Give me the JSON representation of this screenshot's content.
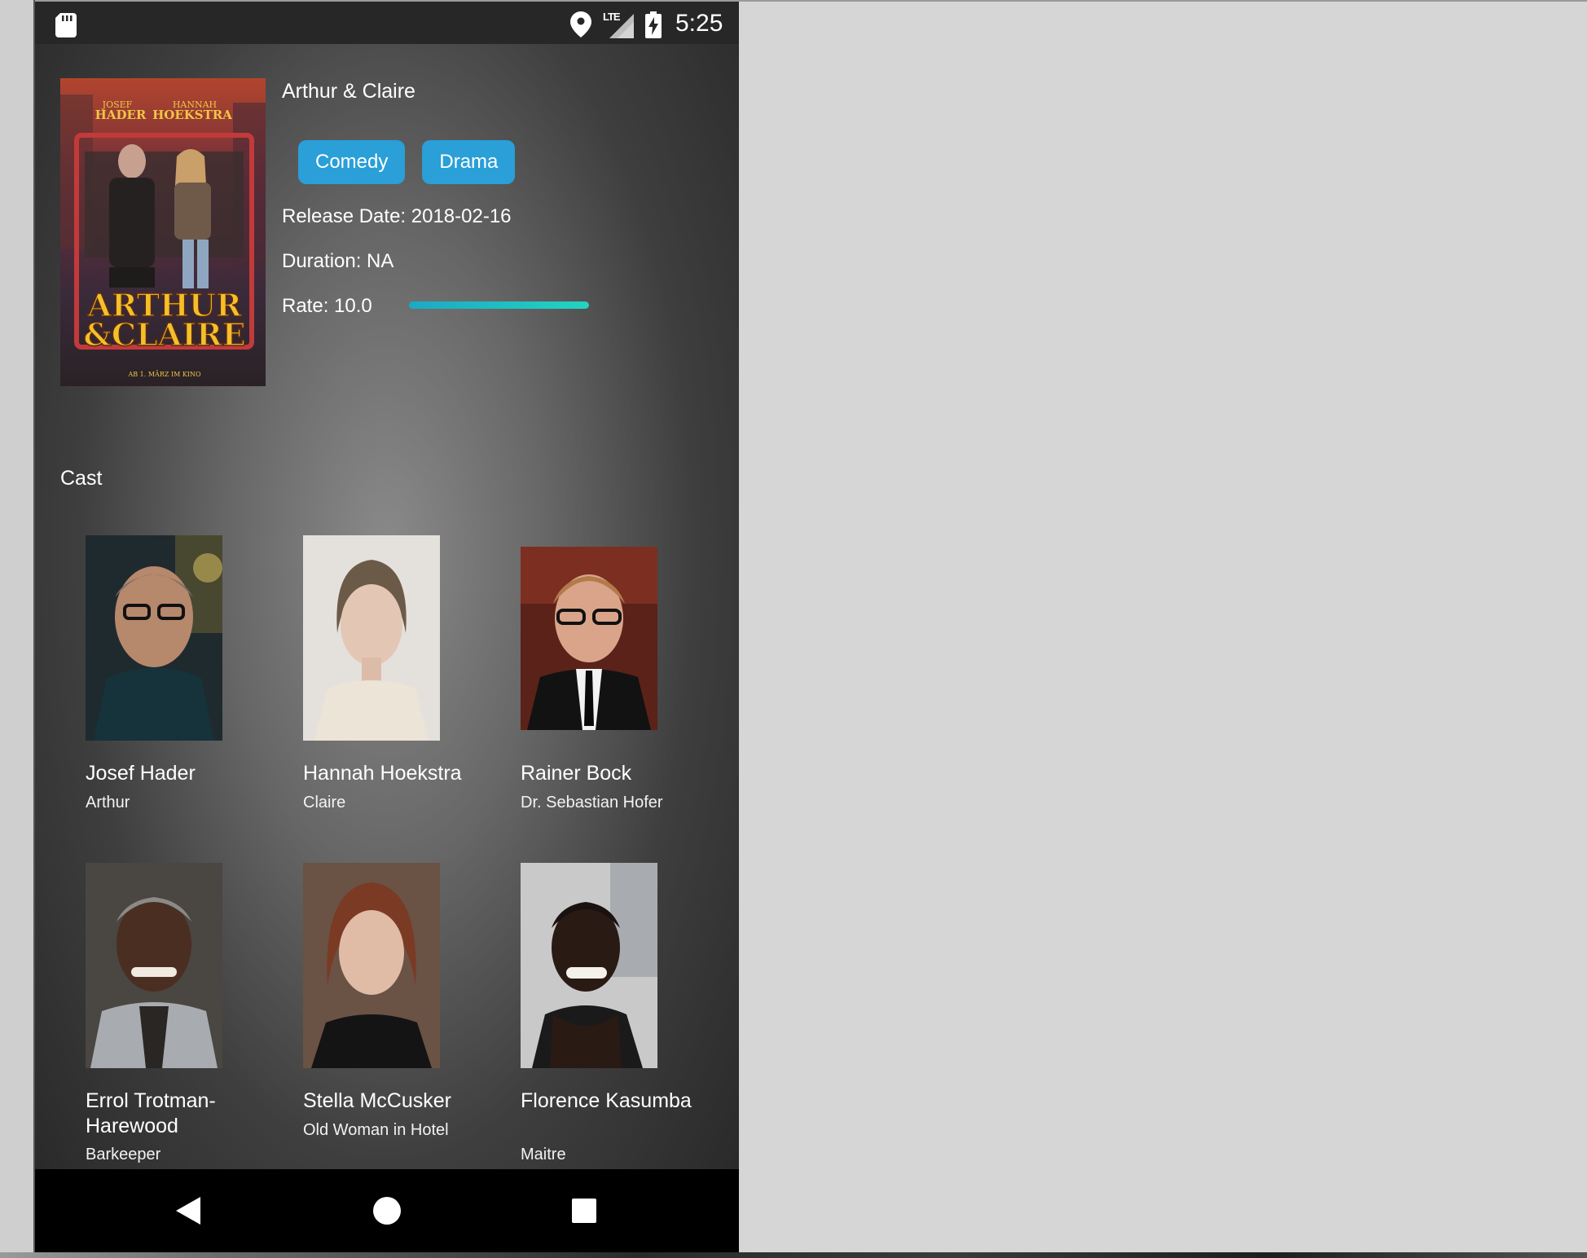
{
  "status_bar": {
    "time": "5:25",
    "network_label": "LTE",
    "icons": [
      "sd-card-icon",
      "location-icon",
      "signal-icon",
      "battery-charging-icon"
    ]
  },
  "movie": {
    "title": "Arthur & Claire",
    "genres": [
      "Comedy",
      "Drama"
    ],
    "release_date": "Release Date: 2018-02-16",
    "duration": "Duration: NA",
    "rate_label": "Rate: 10.0",
    "rate_fraction": 1.0,
    "poster": {
      "top_names": [
        "JOSEF HADER",
        "HANNAH HOEKSTRA"
      ],
      "title_line1": "ARTHUR",
      "title_line2": "&CLAIRE",
      "footer": "AB 1. MÄRZ IM KINO"
    }
  },
  "cast": {
    "heading": "Cast",
    "members": [
      {
        "name": "Josef Hader",
        "role": "Arthur"
      },
      {
        "name": "Hannah Hoekstra",
        "role": "Claire"
      },
      {
        "name": "Rainer Bock",
        "role": "Dr. Sebastian Hofer"
      },
      {
        "name": "Errol Trotman-Harewood",
        "role": "Barkeeper"
      },
      {
        "name": "Stella McCusker",
        "role": "Old Woman in Hotel"
      },
      {
        "name": "Florence Kasumba",
        "role": "Maitre"
      }
    ]
  },
  "navigation": {
    "back": "back-icon",
    "home": "home-icon",
    "recents": "recents-icon"
  },
  "colors": {
    "accent_chip": "#2a9fd8",
    "rate_bar": "#23d3c0",
    "nav_background": "#000000",
    "status_background": "#272727"
  }
}
